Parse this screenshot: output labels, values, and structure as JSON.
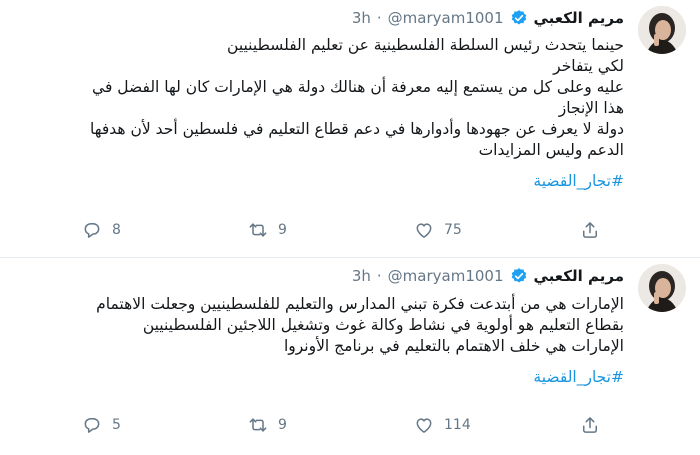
{
  "tweets": [
    {
      "author_name": "مريم الكعبي",
      "handle": "@maryam1001",
      "separator": "·",
      "time": "3h",
      "lines": [
        "حينما يتحدث رئيس السلطة الفلسطينية عن تعليم الفلسطينيين",
        "لكي يتفاخر",
        "عليه وعلى كل من يستمع إليه معرفة أن هنالك دولة هي الإمارات كان لها الفضل في",
        "هذا الإنجاز",
        "دولة لا يعرف عن جهودها وأدوارها في دعم قطاع التعليم في فلسطين أحد لأن هدفها",
        "الدعم وليس المزايدات"
      ],
      "hashtag": "#تجار_القضية",
      "replies": "8",
      "retweets": "9",
      "likes": "75"
    },
    {
      "author_name": "مريم الكعبي",
      "handle": "@maryam1001",
      "separator": "·",
      "time": "3h",
      "lines": [
        "الإمارات هي من أبتدعت فكرة تبني المدارس والتعليم للفلسطينيين وجعلت الاهتمام",
        "بقطاع التعليم هو أولوية في نشاط وكالة غوث وتشغيل اللاجئين الفلسطينيين",
        "الإمارات هي خلف الاهتمام بالتعليم في برنامج الأونروا"
      ],
      "hashtag": "#تجار_القضية",
      "replies": "5",
      "retweets": "9",
      "likes": "114"
    }
  ],
  "icons": {
    "verified": "verified-badge-icon",
    "reply": "reply-icon",
    "retweet": "retweet-icon",
    "like": "heart-icon",
    "share": "share-icon"
  },
  "colors": {
    "link": "#1b95e0",
    "verified": "#1da1f2",
    "muted": "#657786",
    "text": "#14171a",
    "divider": "#e6ecf0"
  }
}
